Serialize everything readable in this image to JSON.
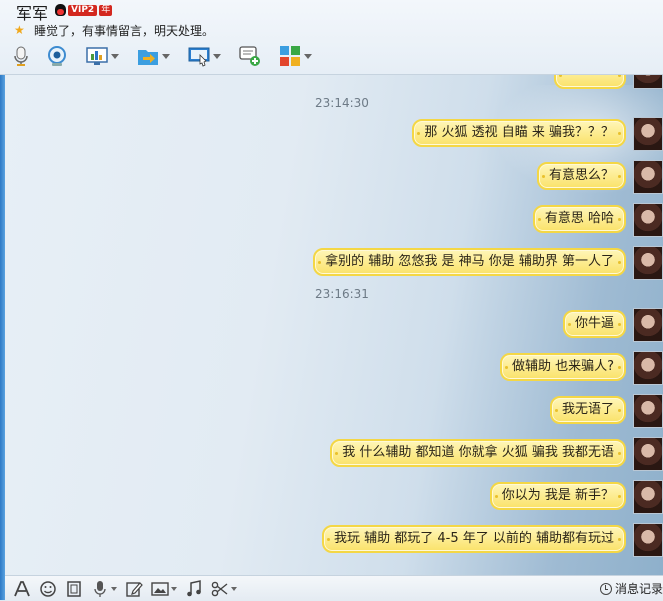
{
  "header": {
    "contact_name": "军军",
    "vip_label": "VIP2",
    "vip_year": "年",
    "signature": "睡觉了，有事情留言，明天处理。"
  },
  "toolbar": {
    "icons": [
      "microphone-icon",
      "webcam-icon",
      "share-screen-icon",
      "send-file-icon",
      "remote-desktop-icon",
      "message-add-icon",
      "apps-icon"
    ]
  },
  "chat": {
    "timestamps": [
      "23:14:30",
      "23:16:31"
    ],
    "messages": [
      "那 火狐 透视 自瞄 来 骗我？？？",
      "有意思么？",
      "有意思 哈哈",
      "拿别的 辅助 忽悠我 是 神马 你是 辅助界 第一人了",
      "你牛逼",
      "做辅助 也来骗人?",
      "我无语了",
      "我 什么辅助 都知道 你就拿 火狐 骗我 我都无语",
      "你以为 我是 新手？",
      "我玩 辅助 都玩了 4-5 年了 以前的 辅助都有玩过"
    ]
  },
  "bottom_toolbar": {
    "history_label": "消息记录"
  },
  "colors": {
    "bubble_fill": "#fae26a",
    "bubble_border": "#f4d745",
    "left_edge": "#2d79c5"
  }
}
